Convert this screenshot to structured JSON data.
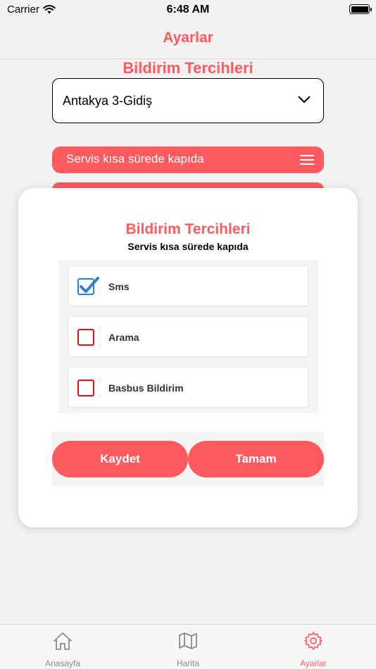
{
  "status_bar": {
    "carrier": "Carrier",
    "time": "6:48 AM"
  },
  "nav": {
    "title": "Ayarlar"
  },
  "section": {
    "title": "Bildirim Tercihleri"
  },
  "route_select": {
    "value": "Antakya 3-Gidiş"
  },
  "notification_rows": [
    {
      "label": "Servis kısa sürede kapıda"
    }
  ],
  "modal": {
    "title": "Bildirim Tercihleri",
    "subtitle": "Servis kısa sürede kapıda",
    "options": [
      {
        "label": "Sms",
        "checked": true
      },
      {
        "label": "Arama",
        "checked": false
      },
      {
        "label": "Basbus Bildirim",
        "checked": false
      }
    ],
    "save_label": "Kaydet",
    "ok_label": "Tamam"
  },
  "tabs": [
    {
      "label": "Anasayfa",
      "icon": "home-icon",
      "active": false
    },
    {
      "label": "Harita",
      "icon": "map-icon",
      "active": false
    },
    {
      "label": "Ayarlar",
      "icon": "gear-icon",
      "active": true
    }
  ],
  "colors": {
    "accent": "#ff5a5f",
    "checkbox_checked": "#2f7fd0",
    "checkbox_unchecked": "#dd1111"
  }
}
